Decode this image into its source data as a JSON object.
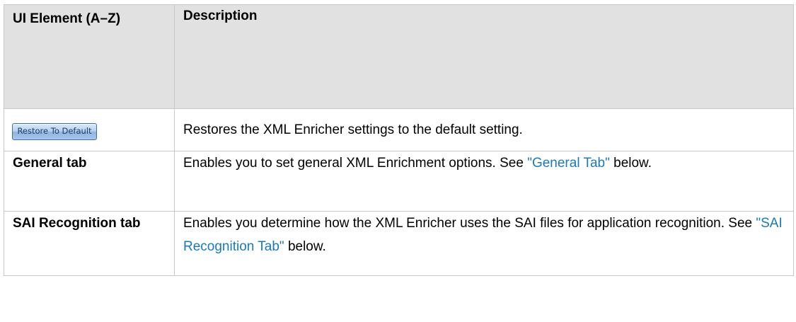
{
  "table": {
    "headers": {
      "element": "UI Element (A–Z)",
      "description": "Description"
    },
    "rows": {
      "restore": {
        "button_label": "Restore To Default",
        "description": "Restores the XML Enricher settings to the default setting."
      },
      "general": {
        "element": "General tab",
        "desc_before": "Enables you to set general XML Enrichment options. See ",
        "link": "\"General Tab\"",
        "desc_after": " below."
      },
      "sai": {
        "element": "SAI Recognition tab",
        "desc_before": "Enables you determine how the XML Enricher uses the SAI files for application recognition. See ",
        "link": "\"SAI Recognition Tab\"",
        "desc_after": " below."
      }
    }
  },
  "colors": {
    "header_bg": "#e1e1e1",
    "border": "#c8c8c8",
    "link": "#1a7ab8"
  }
}
